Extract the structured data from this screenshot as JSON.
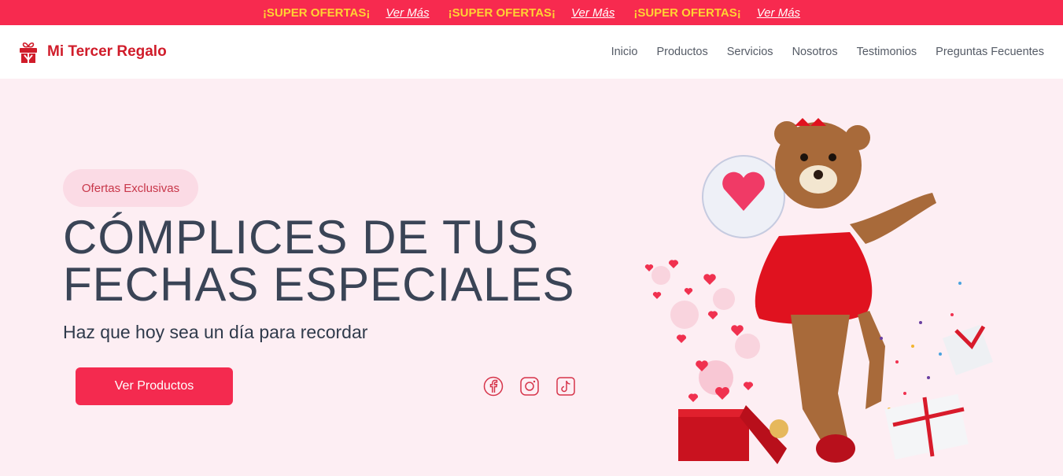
{
  "promo_bar": {
    "items": [
      {
        "text": "¡SUPER OFERTAS¡",
        "link": "Ver Más"
      },
      {
        "text": "¡SUPER OFERTAS¡",
        "link": "Ver Más"
      },
      {
        "text": "¡SUPER OFERTAS¡",
        "link": "Ver Más"
      }
    ],
    "bg_color": "#f72a4f",
    "text_color": "#ffd233"
  },
  "header": {
    "brand": "Mi Tercer Regalo",
    "brand_color": "#d01c2a",
    "nav": [
      "Inicio",
      "Productos",
      "Servicios",
      "Nosotros",
      "Testimonios",
      "Preguntas Fecuentes"
    ]
  },
  "hero": {
    "badge": "Ofertas Exclusivas",
    "headline_line1": "CÓMPLICES DE TUS",
    "headline_line2": "FECHAS ESPECIALES",
    "subtitle": "Haz que hoy sea un día para recordar",
    "cta_label": "Ver Productos",
    "accent_color": "#f42a4f",
    "social_icons": [
      "facebook-icon",
      "instagram-icon",
      "tiktok-icon"
    ]
  }
}
